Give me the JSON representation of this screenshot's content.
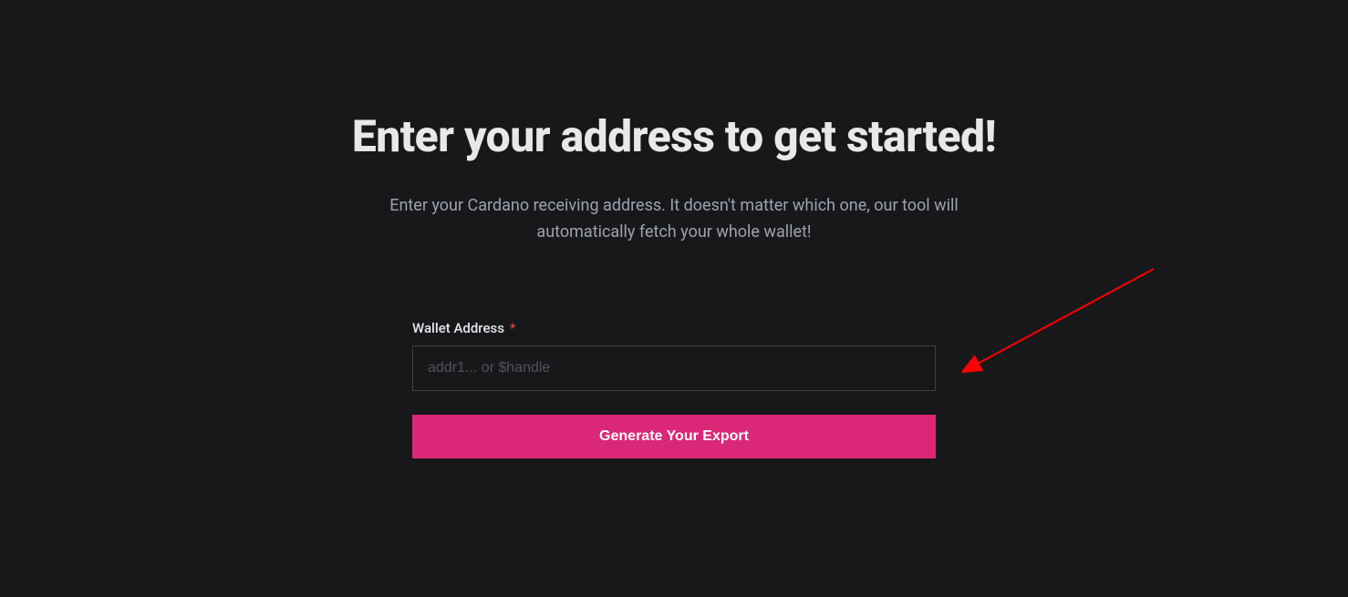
{
  "heading": "Enter your address to get started!",
  "subtitle": "Enter your Cardano receiving address. It doesn't matter which one, our tool will automatically fetch your whole wallet!",
  "form": {
    "wallet_label": "Wallet Address",
    "required_mark": "*",
    "wallet_placeholder": "addr1... or $handle",
    "wallet_value": "",
    "submit_label": "Generate Your Export"
  },
  "colors": {
    "background": "#18181b",
    "heading_text": "#e7e8ea",
    "subtitle_text": "#9ca3af",
    "input_border": "#3f3f46",
    "placeholder": "#52525b",
    "button_bg": "#db2777",
    "required": "#ef4444",
    "arrow": "#ff0000"
  }
}
